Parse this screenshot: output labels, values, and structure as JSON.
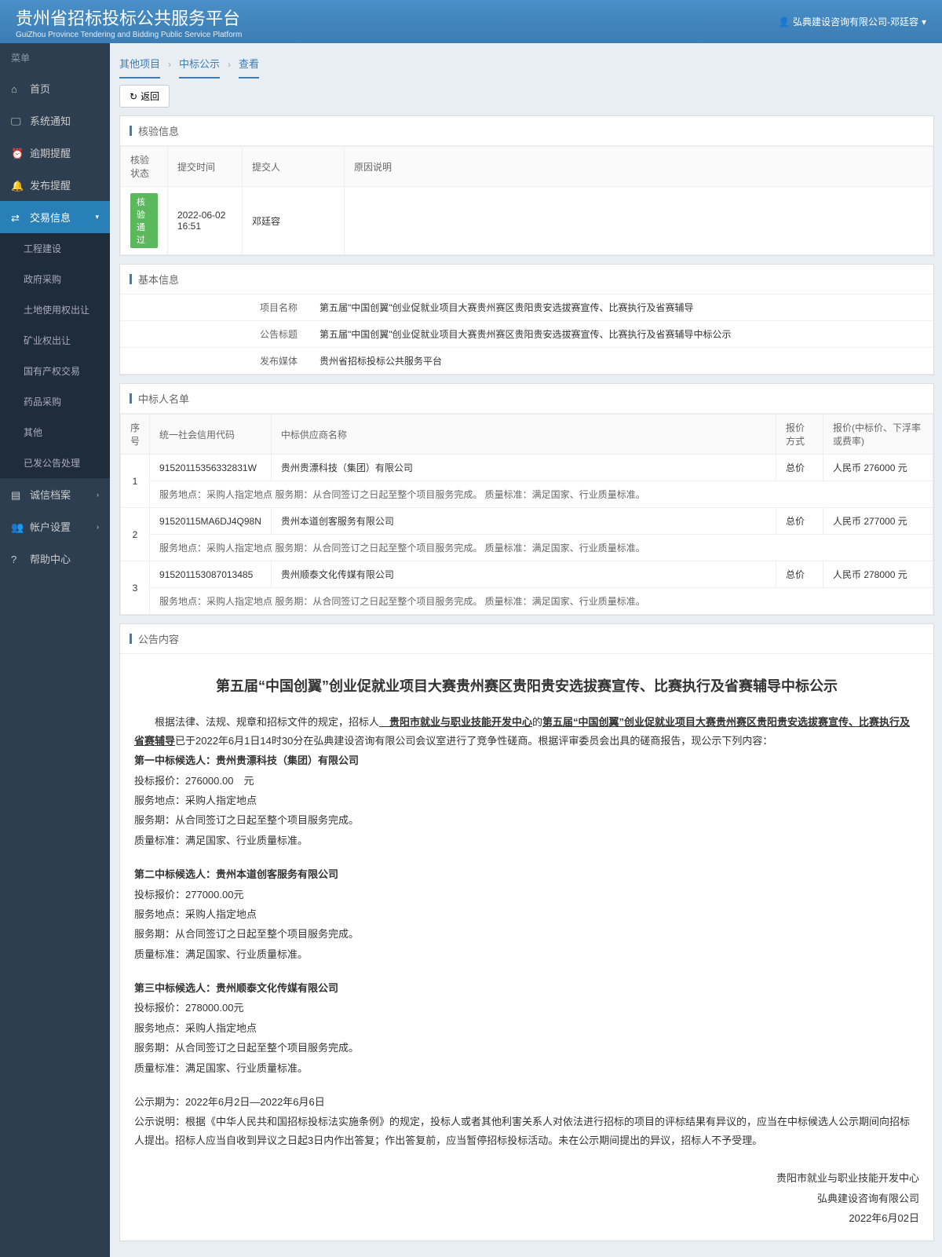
{
  "header": {
    "title": "贵州省招标投标公共服务平台",
    "subtitle": "GuiZhou Province Tendering and Bidding Public Service Platform",
    "user": "弘典建设咨询有限公司-邓廷容"
  },
  "sidebar": {
    "menu_label": "菜单",
    "items": {
      "home": "首页",
      "sysnotice": "系统通知",
      "overdue": "逾期提醒",
      "publish": "发布提醒",
      "trade": "交易信息",
      "integrity": "诚信档案",
      "account": "帐户设置",
      "help": "帮助中心"
    },
    "sub": {
      "eng": "工程建设",
      "gov": "政府采购",
      "land": "土地使用权出让",
      "mine": "矿业权出让",
      "state": "国有产权交易",
      "drug": "药品采购",
      "other": "其他",
      "sent": "已发公告处理"
    }
  },
  "breadcrumb": {
    "a": "其他项目",
    "b": "中标公示",
    "c": "查看"
  },
  "back": "返回",
  "panel1": {
    "title": "核验信息",
    "headers": {
      "status": "核验状态",
      "time": "提交时间",
      "person": "提交人",
      "reason": "原因说明"
    },
    "row": {
      "status": "核验通过",
      "time": "2022-06-02 16:51",
      "person": "邓廷容",
      "reason": ""
    }
  },
  "panel2": {
    "title": "基本信息",
    "labels": {
      "name": "项目名称",
      "ann": "公告标题",
      "media": "发布媒体"
    },
    "vals": {
      "name": "第五届\"中国创翼\"创业促就业项目大赛贵州赛区贵阳贵安选拔赛宣传、比赛执行及省赛辅导",
      "ann": "第五届\"中国创翼\"创业促就业项目大赛贵州赛区贵阳贵安选拔赛宣传、比赛执行及省赛辅导中标公示",
      "media": "贵州省招标投标公共服务平台"
    }
  },
  "panel3": {
    "title": "中标人名单",
    "headers": {
      "no": "序号",
      "code": "统一社会信用代码",
      "name": "中标供应商名称",
      "method": "报价方式",
      "price": "报价(中标价、下浮率或费率)"
    },
    "rows": [
      {
        "no": "1",
        "code": "91520115356332831W",
        "name": "贵州贵漂科技（集团）有限公司",
        "method": "总价",
        "price": "人民币 276000 元",
        "detail": "服务地点：采购人指定地点 服务期：从合同签订之日起至整个项目服务完成。 质量标准：满足国家、行业质量标准。"
      },
      {
        "no": "2",
        "code": "91520115MA6DJ4Q98N",
        "name": "贵州本道创客服务有限公司",
        "method": "总价",
        "price": "人民币 277000 元",
        "detail": "服务地点：采购人指定地点 服务期：从合同签订之日起至整个项目服务完成。 质量标准：满足国家、行业质量标准。"
      },
      {
        "no": "3",
        "code": "915201153087013485",
        "name": "贵州顺泰文化传媒有限公司",
        "method": "总价",
        "price": "人民币 278000 元",
        "detail": "服务地点：采购人指定地点 服务期：从合同签订之日起至整个项目服务完成。 质量标准：满足国家、行业质量标准。"
      }
    ]
  },
  "panel4": {
    "title": "公告内容",
    "heading": "第五届“中国创翼”创业促就业项目大赛贵州赛区贵阳贵安选拔赛宣传、比赛执行及省赛辅导中标公示",
    "intro1": "根据法律、法规、规章和招标文件的规定，招标人",
    "intro_u1": "　贵阳市就业与职业技能开发中心",
    "intro2": "的",
    "intro_u2": "第五届“中国创翼”创业促就业项目大赛贵州赛区贵阳贵安选拔赛宣传、比赛执行及省赛辅导",
    "intro3": "已于2022年6月1日14时30分在弘典建设咨询有限公司会议室进行了竞争性磋商。根据评审委员会出具的磋商报告，现公示下列内容：",
    "c1": {
      "t": "第一中标候选人：贵州贵漂科技（集团）有限公司",
      "p": "投标报价：276000.00　元",
      "l": "服务地点：采购人指定地点",
      "s": "服务期：从合同签订之日起至整个项目服务完成。",
      "q": "质量标准：满足国家、行业质量标准。"
    },
    "c2": {
      "t": "第二中标候选人：贵州本道创客服务有限公司",
      "p": "投标报价：277000.00元",
      "l": "服务地点：采购人指定地点",
      "s": "服务期：从合同签订之日起至整个项目服务完成。",
      "q": "质量标准：满足国家、行业质量标准。"
    },
    "c3": {
      "t": "第三中标候选人：贵州顺泰文化传媒有限公司",
      "p": "投标报价：278000.00元",
      "l": "服务地点：采购人指定地点",
      "s": "服务期：从合同签订之日起至整个项目服务完成。",
      "q": "质量标准：满足国家、行业质量标准。"
    },
    "period": "公示期为：2022年6月2日―2022年6月6日",
    "explain": "公示说明：根据《中华人民共和国招标投标法实施条例》的规定，投标人或者其他利害关系人对依法进行招标的项目的评标结果有异议的，应当在中标候选人公示期间向招标人提出。招标人应当自收到异议之日起3日内作出答复；作出答复前，应当暂停招标投标活动。未在公示期间提出的异议，招标人不予受理。",
    "sig1": "贵阳市就业与职业技能开发中心",
    "sig2": "弘典建设咨询有限公司",
    "sig3": "2022年6月02日"
  }
}
